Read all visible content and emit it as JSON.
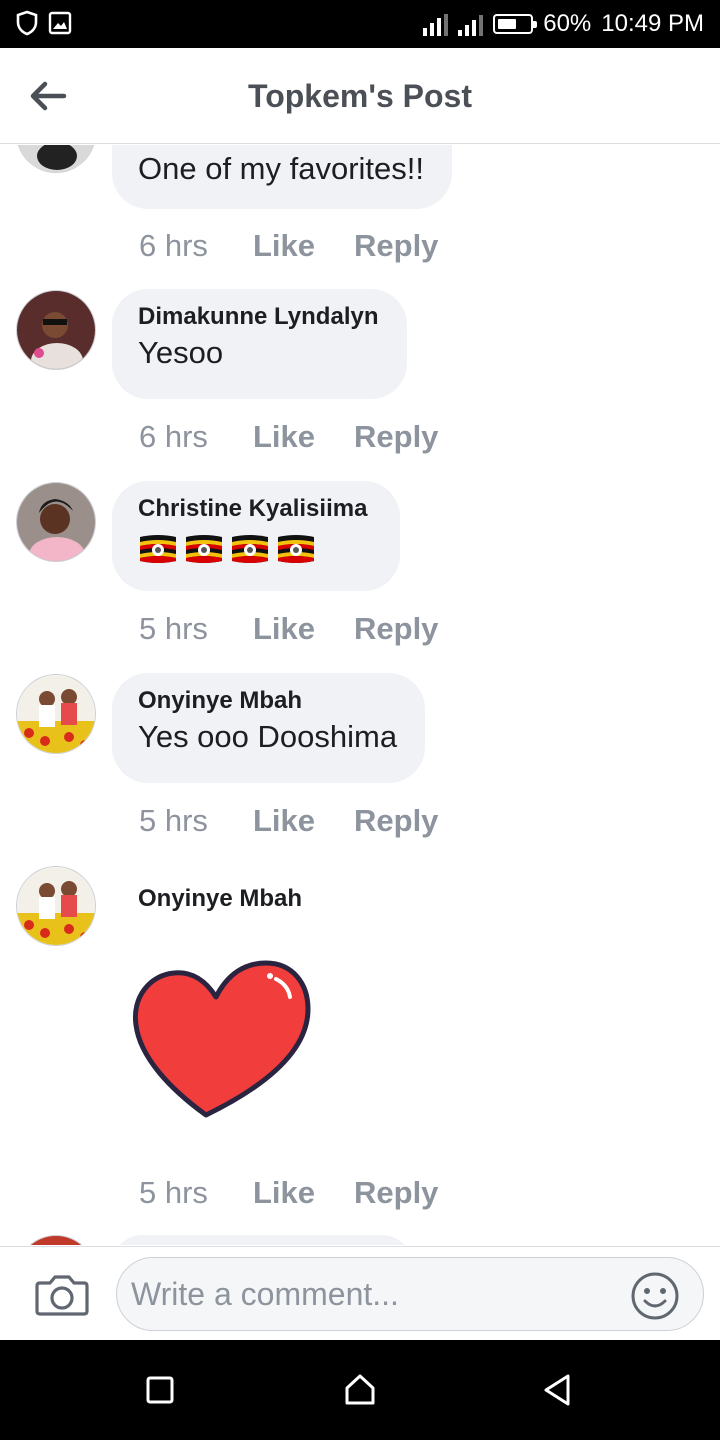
{
  "status_bar": {
    "battery_percent": "60%",
    "battery_level": 0.6,
    "time": "10:49 PM",
    "left_icons": [
      "shield-icon",
      "image-icon"
    ],
    "right_icons": [
      "signal-icon",
      "signal-icon",
      "battery-icon"
    ]
  },
  "header": {
    "title": "Topkem's Post",
    "back_icon": "arrow-left-icon"
  },
  "comments": [
    {
      "author": "",
      "text": "One of my favorites!!",
      "time": "6 hrs",
      "like": "Like",
      "reply": "Reply"
    },
    {
      "author": "Dimakunne Lyndalyn",
      "text": "Yesoo",
      "time": "6 hrs",
      "like": "Like",
      "reply": "Reply"
    },
    {
      "author": "Christine Kyalisiima",
      "text": "",
      "reaction_emoji": [
        "flag-uganda-icon",
        "flag-uganda-icon",
        "flag-uganda-icon",
        "flag-uganda-icon"
      ],
      "time": "5 hrs",
      "like": "Like",
      "reply": "Reply"
    },
    {
      "author": "Onyinye Mbah",
      "text": "Yes ooo Dooshima",
      "time": "5 hrs",
      "like": "Like",
      "reply": "Reply"
    },
    {
      "author": "Onyinye Mbah",
      "text": "",
      "sticker": "heart-sticker-icon",
      "time": "5 hrs",
      "like": "Like",
      "reply": "Reply"
    }
  ],
  "composer": {
    "placeholder": "Write a comment...",
    "camera_icon": "camera-icon",
    "emoji_icon": "smiley-icon"
  },
  "nav_bar": {
    "icons": [
      "recent-apps-icon",
      "home-icon",
      "back-icon"
    ]
  },
  "colors": {
    "bubble": "#f0f2f5",
    "meta_text": "#8d949e",
    "title_text": "#4b4f56",
    "heart_red": "#f23d3d"
  }
}
